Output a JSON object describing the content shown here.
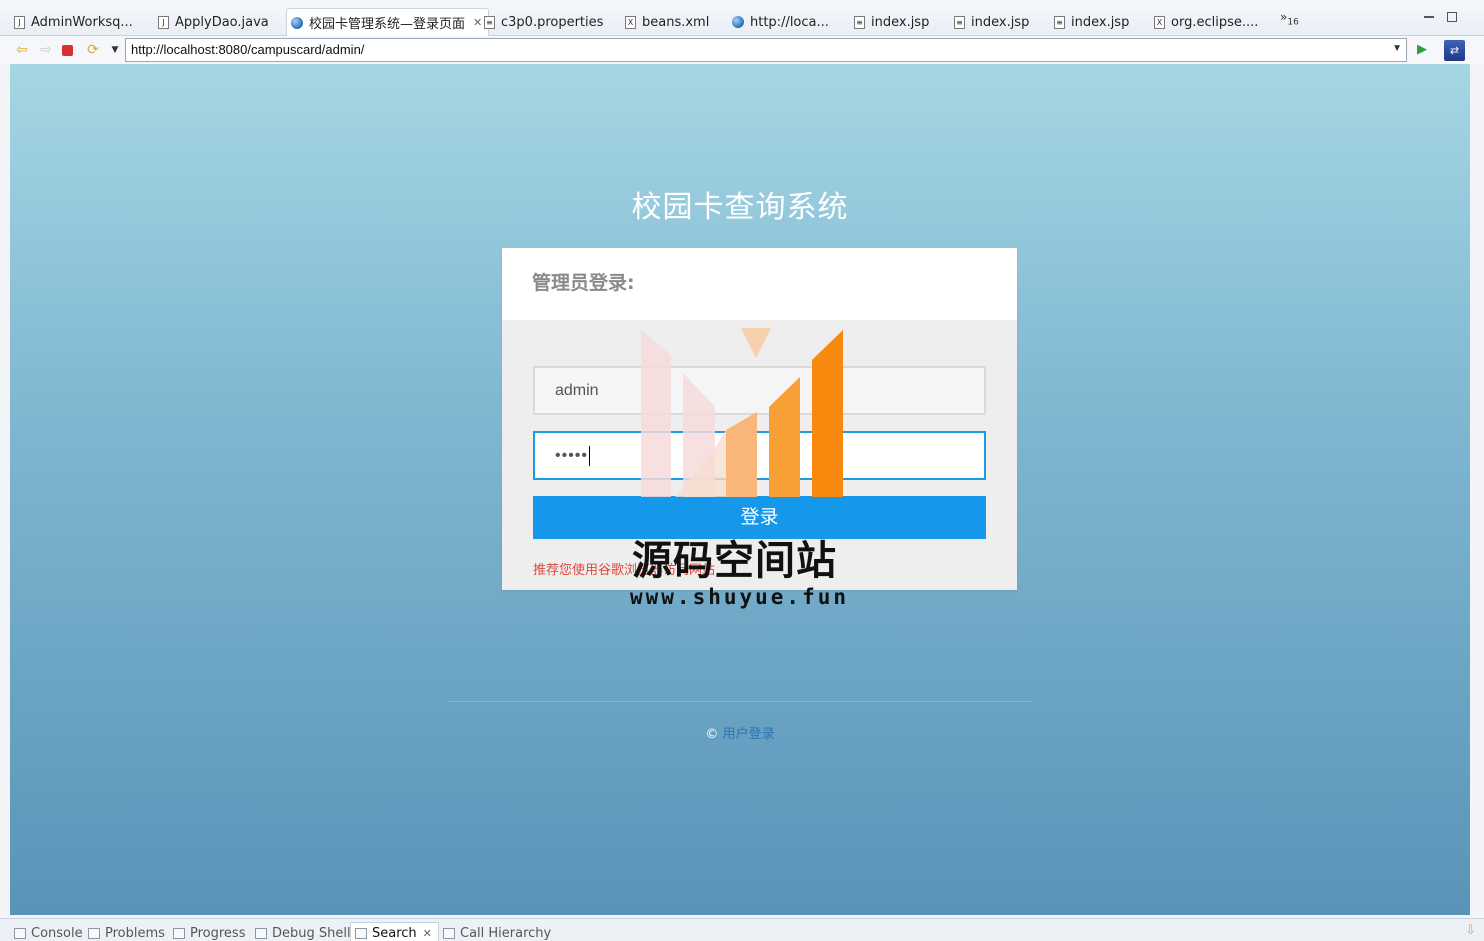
{
  "editor_tabs": [
    {
      "label": "AdminWorksq...",
      "icon": "java-file-icon",
      "active": false
    },
    {
      "label": "ApplyDao.java",
      "icon": "java-file-icon",
      "active": false
    },
    {
      "label": "校园卡管理系统—登录页面",
      "icon": "globe-icon",
      "active": true
    },
    {
      "label": "c3p0.properties",
      "icon": "text-file-icon",
      "active": false
    },
    {
      "label": "beans.xml",
      "icon": "xml-file-icon",
      "active": false
    },
    {
      "label": "http://loca...",
      "icon": "globe-icon",
      "active": false
    },
    {
      "label": "index.jsp",
      "icon": "text-file-icon",
      "active": false
    },
    {
      "label": "index.jsp",
      "icon": "text-file-icon",
      "active": false
    },
    {
      "label": "index.jsp",
      "icon": "text-file-icon",
      "active": false
    },
    {
      "label": "org.eclipse....",
      "icon": "xml-file-icon",
      "active": false
    }
  ],
  "tab_overflow": {
    "symbol": "»",
    "count": "16"
  },
  "browser": {
    "url": "http://localhost:8080/campuscard/admin/"
  },
  "page": {
    "system_title": "校园卡查询系统",
    "card_title": "管理员登录:",
    "username_value": "admin",
    "password_mask": "•••••",
    "login_button": "登录",
    "hint": "推荐您使用谷歌浏览器访问网站",
    "footer_symbol": "©",
    "footer_link": "用户登录"
  },
  "watermark": {
    "text_cn": "源码空间站",
    "text_en": "www.shuyue.fun"
  },
  "bottom_tabs": [
    {
      "label": "Console",
      "active": false
    },
    {
      "label": "Problems",
      "active": false
    },
    {
      "label": "Progress",
      "active": false
    },
    {
      "label": "Debug Shell",
      "active": false
    },
    {
      "label": "Search",
      "active": true
    },
    {
      "label": "Call Hierarchy",
      "active": false
    }
  ],
  "colors": {
    "accent_blue": "#1597ea",
    "hint_red": "#e0483e",
    "watermark_orange": "#f7890f"
  }
}
